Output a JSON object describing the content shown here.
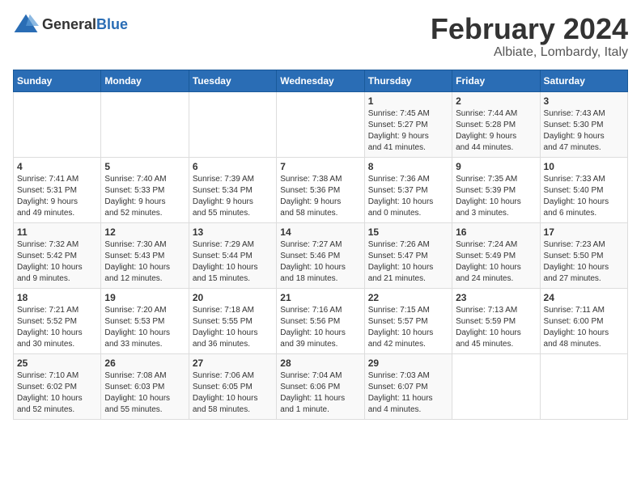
{
  "logo": {
    "general": "General",
    "blue": "Blue"
  },
  "calendar": {
    "title": "February 2024",
    "subtitle": "Albiate, Lombardy, Italy"
  },
  "days_of_week": [
    "Sunday",
    "Monday",
    "Tuesday",
    "Wednesday",
    "Thursday",
    "Friday",
    "Saturday"
  ],
  "weeks": [
    [
      {
        "day": "",
        "info": ""
      },
      {
        "day": "",
        "info": ""
      },
      {
        "day": "",
        "info": ""
      },
      {
        "day": "",
        "info": ""
      },
      {
        "day": "1",
        "info": "Sunrise: 7:45 AM\nSunset: 5:27 PM\nDaylight: 9 hours\nand 41 minutes."
      },
      {
        "day": "2",
        "info": "Sunrise: 7:44 AM\nSunset: 5:28 PM\nDaylight: 9 hours\nand 44 minutes."
      },
      {
        "day": "3",
        "info": "Sunrise: 7:43 AM\nSunset: 5:30 PM\nDaylight: 9 hours\nand 47 minutes."
      }
    ],
    [
      {
        "day": "4",
        "info": "Sunrise: 7:41 AM\nSunset: 5:31 PM\nDaylight: 9 hours\nand 49 minutes."
      },
      {
        "day": "5",
        "info": "Sunrise: 7:40 AM\nSunset: 5:33 PM\nDaylight: 9 hours\nand 52 minutes."
      },
      {
        "day": "6",
        "info": "Sunrise: 7:39 AM\nSunset: 5:34 PM\nDaylight: 9 hours\nand 55 minutes."
      },
      {
        "day": "7",
        "info": "Sunrise: 7:38 AM\nSunset: 5:36 PM\nDaylight: 9 hours\nand 58 minutes."
      },
      {
        "day": "8",
        "info": "Sunrise: 7:36 AM\nSunset: 5:37 PM\nDaylight: 10 hours\nand 0 minutes."
      },
      {
        "day": "9",
        "info": "Sunrise: 7:35 AM\nSunset: 5:39 PM\nDaylight: 10 hours\nand 3 minutes."
      },
      {
        "day": "10",
        "info": "Sunrise: 7:33 AM\nSunset: 5:40 PM\nDaylight: 10 hours\nand 6 minutes."
      }
    ],
    [
      {
        "day": "11",
        "info": "Sunrise: 7:32 AM\nSunset: 5:42 PM\nDaylight: 10 hours\nand 9 minutes."
      },
      {
        "day": "12",
        "info": "Sunrise: 7:30 AM\nSunset: 5:43 PM\nDaylight: 10 hours\nand 12 minutes."
      },
      {
        "day": "13",
        "info": "Sunrise: 7:29 AM\nSunset: 5:44 PM\nDaylight: 10 hours\nand 15 minutes."
      },
      {
        "day": "14",
        "info": "Sunrise: 7:27 AM\nSunset: 5:46 PM\nDaylight: 10 hours\nand 18 minutes."
      },
      {
        "day": "15",
        "info": "Sunrise: 7:26 AM\nSunset: 5:47 PM\nDaylight: 10 hours\nand 21 minutes."
      },
      {
        "day": "16",
        "info": "Sunrise: 7:24 AM\nSunset: 5:49 PM\nDaylight: 10 hours\nand 24 minutes."
      },
      {
        "day": "17",
        "info": "Sunrise: 7:23 AM\nSunset: 5:50 PM\nDaylight: 10 hours\nand 27 minutes."
      }
    ],
    [
      {
        "day": "18",
        "info": "Sunrise: 7:21 AM\nSunset: 5:52 PM\nDaylight: 10 hours\nand 30 minutes."
      },
      {
        "day": "19",
        "info": "Sunrise: 7:20 AM\nSunset: 5:53 PM\nDaylight: 10 hours\nand 33 minutes."
      },
      {
        "day": "20",
        "info": "Sunrise: 7:18 AM\nSunset: 5:55 PM\nDaylight: 10 hours\nand 36 minutes."
      },
      {
        "day": "21",
        "info": "Sunrise: 7:16 AM\nSunset: 5:56 PM\nDaylight: 10 hours\nand 39 minutes."
      },
      {
        "day": "22",
        "info": "Sunrise: 7:15 AM\nSunset: 5:57 PM\nDaylight: 10 hours\nand 42 minutes."
      },
      {
        "day": "23",
        "info": "Sunrise: 7:13 AM\nSunset: 5:59 PM\nDaylight: 10 hours\nand 45 minutes."
      },
      {
        "day": "24",
        "info": "Sunrise: 7:11 AM\nSunset: 6:00 PM\nDaylight: 10 hours\nand 48 minutes."
      }
    ],
    [
      {
        "day": "25",
        "info": "Sunrise: 7:10 AM\nSunset: 6:02 PM\nDaylight: 10 hours\nand 52 minutes."
      },
      {
        "day": "26",
        "info": "Sunrise: 7:08 AM\nSunset: 6:03 PM\nDaylight: 10 hours\nand 55 minutes."
      },
      {
        "day": "27",
        "info": "Sunrise: 7:06 AM\nSunset: 6:05 PM\nDaylight: 10 hours\nand 58 minutes."
      },
      {
        "day": "28",
        "info": "Sunrise: 7:04 AM\nSunset: 6:06 PM\nDaylight: 11 hours\nand 1 minute."
      },
      {
        "day": "29",
        "info": "Sunrise: 7:03 AM\nSunset: 6:07 PM\nDaylight: 11 hours\nand 4 minutes."
      },
      {
        "day": "",
        "info": ""
      },
      {
        "day": "",
        "info": ""
      }
    ]
  ]
}
